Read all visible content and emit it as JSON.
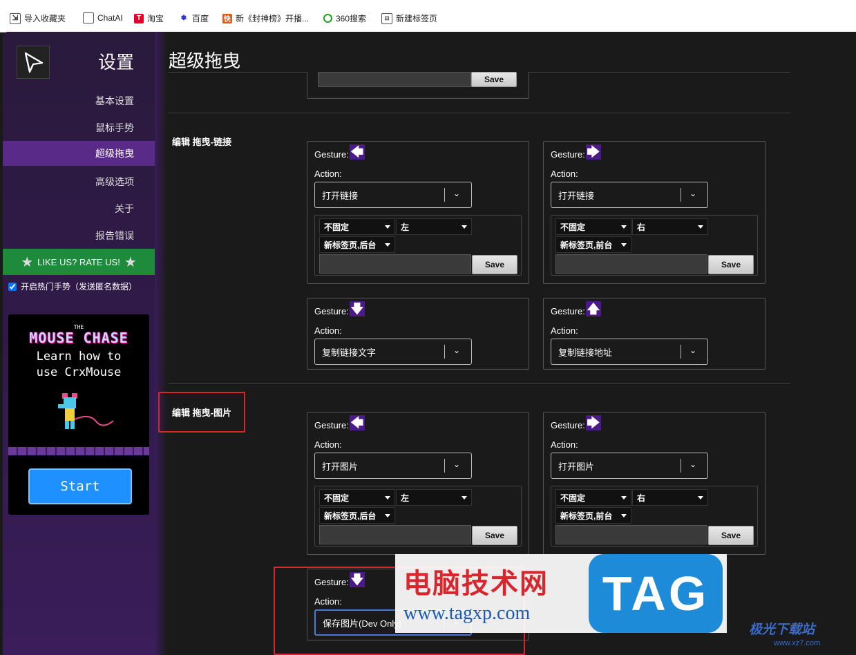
{
  "bookmarks": [
    {
      "label": "导入收藏夹",
      "icon": "import-icon"
    },
    {
      "label": "ChatAI",
      "icon": "page-icon"
    },
    {
      "label": "淘宝",
      "icon": "taobao-icon"
    },
    {
      "label": "百度",
      "icon": "baidu-icon"
    },
    {
      "label": "新《封神榜》开播...",
      "icon": "fengshen-icon"
    },
    {
      "label": "360搜索",
      "icon": "360-icon"
    },
    {
      "label": "新建标签页",
      "icon": "newtab-icon"
    }
  ],
  "sidebar": {
    "title": "设置",
    "items": [
      {
        "label": "基本设置"
      },
      {
        "label": "鼠标手势"
      },
      {
        "label": "超级拖曳",
        "active": true
      },
      {
        "label": "高级选项"
      },
      {
        "label": "关于"
      },
      {
        "label": "报告错误"
      }
    ],
    "rate_label": "LIKE US? RATE US!",
    "hot_label": "开启热门手势（发送匿名数据）",
    "promo": {
      "title": "MOUSE CHASE",
      "title_small": "THE",
      "line1": "Learn how to",
      "line2": "use CrxMouse",
      "button": "Start"
    }
  },
  "main": {
    "title": "超级拖曳",
    "save_label": "Save",
    "gesture_label": "Gesture:",
    "action_label": "Action:",
    "section_link": "编辑 拖曳-链接",
    "section_image": "编辑 拖曳-图片",
    "link_cards": [
      {
        "arrow": "left",
        "action": "打开链接",
        "opt1": "不固定",
        "opt2": "左",
        "opt3": "新标签页,后台"
      },
      {
        "arrow": "right",
        "action": "打开链接",
        "opt1": "不固定",
        "opt2": "右",
        "opt3": "新标签页,前台"
      },
      {
        "arrow": "down",
        "action": "复制链接文字"
      },
      {
        "arrow": "up",
        "action": "复制链接地址"
      }
    ],
    "image_cards": [
      {
        "arrow": "left",
        "action": "打开图片",
        "opt1": "不固定",
        "opt2": "左",
        "opt3": "新标签页,后台"
      },
      {
        "arrow": "right",
        "action": "打开图片",
        "opt1": "不固定",
        "opt2": "右",
        "opt3": "新标签页,前台"
      },
      {
        "arrow": "down",
        "action": "保存图片(Dev Only)"
      }
    ]
  },
  "watermark": {
    "cn": "电脑技术网",
    "url": "www.tagxp.com",
    "tag": "TAG",
    "site2": "极光下载站",
    "site2_url": "www.xz7.com"
  },
  "colors": {
    "active_nav": "#5a2a88",
    "rate_green": "#1e8a3c",
    "arrow_bg": "#4a1a88"
  }
}
